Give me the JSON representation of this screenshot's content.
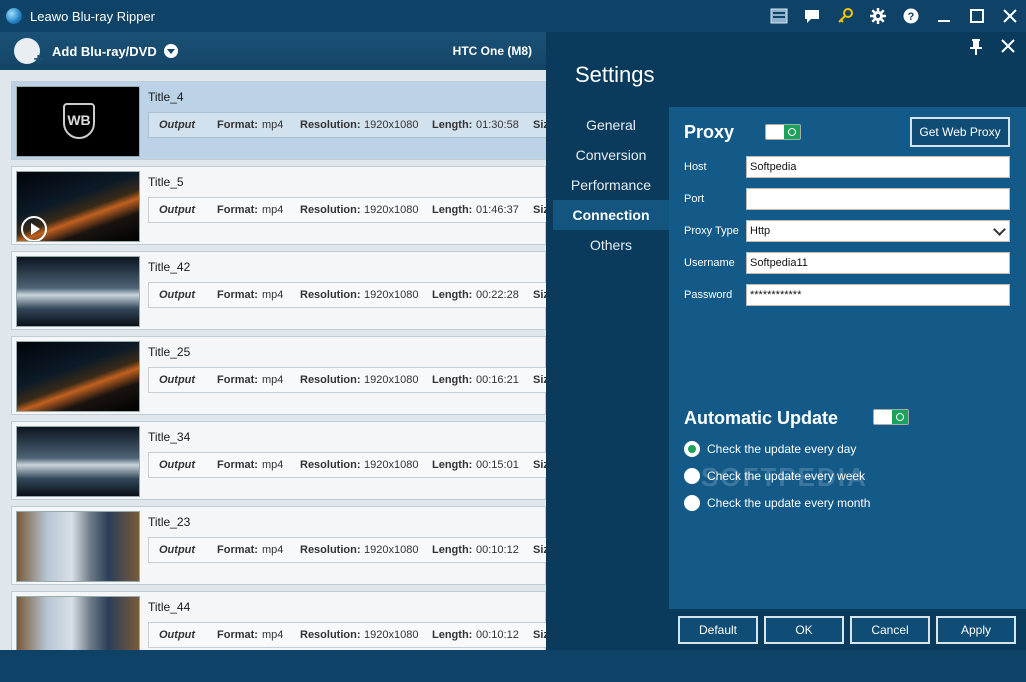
{
  "app": {
    "title": "Leawo Blu-ray Ripper"
  },
  "toolbar": {
    "add_label": "Add Blu-ray/DVD",
    "device": "HTC One (M8)"
  },
  "titles": [
    {
      "name": "Title_4",
      "output": "Output",
      "format_label": "Format:",
      "format": "mp4",
      "res_label": "Resolution:",
      "resolution": "1920x1080",
      "len_label": "Length:",
      "length": "01:30:58",
      "size_label": "Siz"
    },
    {
      "name": "Title_5",
      "output": "Output",
      "format_label": "Format:",
      "format": "mp4",
      "res_label": "Resolution:",
      "resolution": "1920x1080",
      "len_label": "Length:",
      "length": "01:46:37",
      "size_label": "Siz"
    },
    {
      "name": "Title_42",
      "output": "Output",
      "format_label": "Format:",
      "format": "mp4",
      "res_label": "Resolution:",
      "resolution": "1920x1080",
      "len_label": "Length:",
      "length": "00:22:28",
      "size_label": "Siz"
    },
    {
      "name": "Title_25",
      "output": "Output",
      "format_label": "Format:",
      "format": "mp4",
      "res_label": "Resolution:",
      "resolution": "1920x1080",
      "len_label": "Length:",
      "length": "00:16:21",
      "size_label": "Siz"
    },
    {
      "name": "Title_34",
      "output": "Output",
      "format_label": "Format:",
      "format": "mp4",
      "res_label": "Resolution:",
      "resolution": "1920x1080",
      "len_label": "Length:",
      "length": "00:15:01",
      "size_label": "Siz"
    },
    {
      "name": "Title_23",
      "output": "Output",
      "format_label": "Format:",
      "format": "mp4",
      "res_label": "Resolution:",
      "resolution": "1920x1080",
      "len_label": "Length:",
      "length": "00:10:12",
      "size_label": "Siz"
    },
    {
      "name": "Title_44",
      "output": "Output",
      "format_label": "Format:",
      "format": "mp4",
      "res_label": "Resolution:",
      "resolution": "1920x1080",
      "len_label": "Length:",
      "length": "00:10:12",
      "size_label": "Siz"
    }
  ],
  "thumb_logo": "WB",
  "settings": {
    "title": "Settings",
    "nav": [
      "General",
      "Conversion",
      "Performance",
      "Connection",
      "Others"
    ],
    "active_nav": "Connection",
    "proxy": {
      "title": "Proxy",
      "enabled": true,
      "get_web_proxy": "Get Web Proxy",
      "host_label": "Host",
      "host": "Softpedia",
      "port_label": "Port",
      "port": "",
      "type_label": "Proxy Type",
      "type": "Http",
      "username_label": "Username",
      "username": "Softpedia11",
      "password_label": "Password",
      "password": "************"
    },
    "update": {
      "title": "Automatic Update",
      "enabled": true,
      "options": [
        "Check the update every day",
        "Check the update every week",
        "Check the update every month"
      ],
      "selected": "Check the update every day"
    },
    "watermark": "SOFTPEDIA",
    "buttons": {
      "default": "Default",
      "ok": "OK",
      "cancel": "Cancel",
      "apply": "Apply"
    }
  },
  "colors": {
    "accent_green": "#1aa35a",
    "panel_bg": "#0b3b5c",
    "content_bg": "#135a89",
    "selected_row": "#bcd2e6"
  }
}
